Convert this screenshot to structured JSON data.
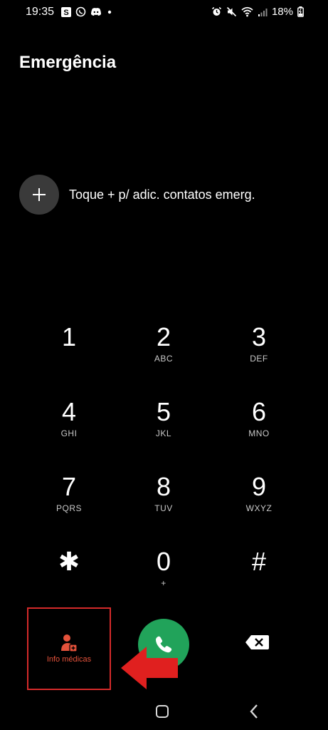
{
  "status_bar": {
    "time": "19:35",
    "battery": "18%"
  },
  "title": "Emergência",
  "add_contact": {
    "label": "Toque + p/ adic. contatos emerg."
  },
  "keypad": {
    "keys": [
      {
        "digit": "1",
        "letters": ""
      },
      {
        "digit": "2",
        "letters": "ABC"
      },
      {
        "digit": "3",
        "letters": "DEF"
      },
      {
        "digit": "4",
        "letters": "GHI"
      },
      {
        "digit": "5",
        "letters": "JKL"
      },
      {
        "digit": "6",
        "letters": "MNO"
      },
      {
        "digit": "7",
        "letters": "PQRS"
      },
      {
        "digit": "8",
        "letters": "TUV"
      },
      {
        "digit": "9",
        "letters": "WXYZ"
      },
      {
        "digit": "✱",
        "letters": ""
      },
      {
        "digit": "0",
        "letters": "+"
      },
      {
        "digit": "#",
        "letters": ""
      }
    ]
  },
  "bottom": {
    "medical_info_label": "Info médicas"
  },
  "colors": {
    "call_green": "#21a35a",
    "highlight_red": "#d42a2a",
    "medical_orange": "#e4523b"
  }
}
